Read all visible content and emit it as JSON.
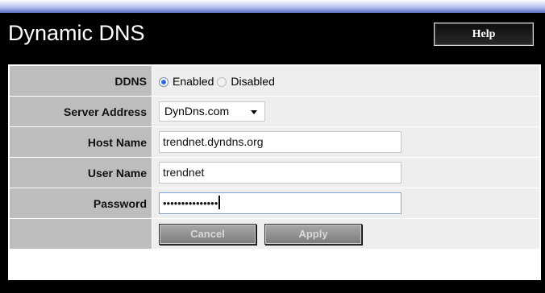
{
  "header": {
    "title": "Dynamic DNS",
    "help_label": "Help"
  },
  "form": {
    "ddns": {
      "label": "DDNS",
      "options": [
        "Enabled",
        "Disabled"
      ],
      "selected": "Enabled"
    },
    "server_address": {
      "label": "Server Address",
      "value": "DynDns.com"
    },
    "host_name": {
      "label": "Host Name",
      "value": "trendnet.dyndns.org"
    },
    "user_name": {
      "label": "User Name",
      "value": "trendnet"
    },
    "password": {
      "label": "Password",
      "masked_value": "•••••••••••••••"
    }
  },
  "actions": {
    "cancel_label": "Cancel",
    "apply_label": "Apply"
  },
  "colors": {
    "header_bg": "#000000",
    "label_cell": "#bdbdbd",
    "value_cell": "#eeeeee",
    "top_strip": "#5d6fc4"
  }
}
